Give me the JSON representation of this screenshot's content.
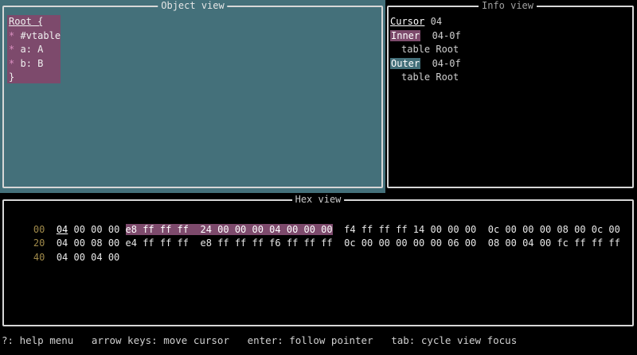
{
  "object_view": {
    "title": "Object view",
    "lines": [
      "Root {",
      "* ",
      "#vtable",
      "* ",
      "a: A",
      "* ",
      "b: B",
      "}"
    ],
    "root_label": "Root {",
    "vtable": "#vtable",
    "field_a": "a: A",
    "field_b": "b: B",
    "close": "}",
    "star": "*",
    "highlight_color": "#7d4a6c"
  },
  "info_view": {
    "title": "Info view",
    "cursor_label": "Cursor",
    "cursor_value": "04",
    "inner_label": "Inner",
    "inner_range": "04-0f",
    "inner_type": "table Root",
    "outer_label": "Outer",
    "outer_range": "04-0f",
    "outer_type": "table Root"
  },
  "hex_view": {
    "title": "Hex view",
    "rows": [
      {
        "addr": "00",
        "c1": "04 00 00 00",
        "c2": "e8 ff ff ff",
        "c3": "24 00 00 00 04 00 00 00",
        "c4": "f4 ff ff ff 14 00 00 00",
        "c5": "0c 00 00 00 08 00 0c 00"
      },
      {
        "addr": "20",
        "c1": "04 00 08 00",
        "c2": "e4 ff ff ff",
        "c3": "e8 ff ff ff f6 ff ff ff",
        "c4": "0c 00 00 00 00 00 06 00",
        "c5": "08 00 04 00 fc ff ff ff"
      },
      {
        "addr": "40",
        "c1": "04 00 04 00",
        "c2": "",
        "c3": "",
        "c4": "",
        "c5": ""
      }
    ],
    "cursor_cell": "04",
    "pink": "#7d4a6c",
    "address_color": "#a08a4a"
  },
  "status_bar": {
    "help": "?: help menu",
    "arrows": "arrow keys: move cursor",
    "enter": "enter: follow pointer",
    "tab": "tab: cycle view focus"
  },
  "colors": {
    "object_bg": "#44707a",
    "border": "#d7d7d7"
  }
}
